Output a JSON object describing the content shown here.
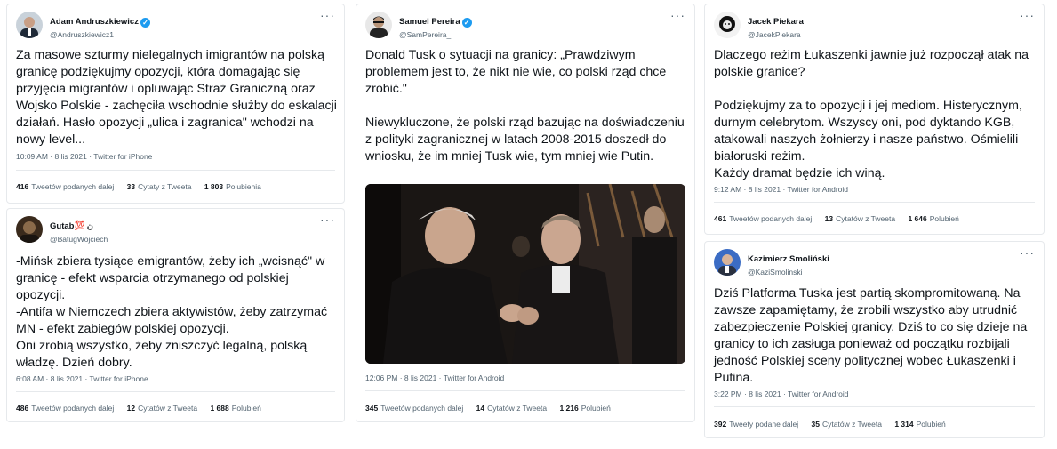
{
  "tweets": [
    {
      "author": "Adam Andruszkiewicz",
      "handle": "@Andruszkiewicz1",
      "text": "Za masowe szturmy nielegalnych imigrantów na polską granicę podziękujmy opozycji, która domagając się przyjęcia migrantów i opluwając Straż Graniczną oraz Wojsko Polskie - zachęciła wschodnie służby do eskalacji działań. Hasło opozycji „ulica i zagranica\" wchodzi na nowy level...",
      "meta": "10:09 AM · 8 lis 2021 · Twitter for iPhone",
      "retweets": "416",
      "retweets_label": "Tweetów podanych dalej",
      "quotes": "33",
      "quotes_label": "Cytaty z Tweeta",
      "likes": "1 803",
      "likes_label": "Polubienia"
    },
    {
      "author": "Gutab💯 ن",
      "handle": "@BatugWojciech",
      "text": "-Mińsk zbiera tysiące emigrantów, żeby ich „wcisnąć\" w granicę - efekt wsparcia otrzymanego od polskiej opozycji.\n-Antifa w Niemczech zbiera aktywistów, żeby zatrzymać MN - efekt zabiegów polskiej opozycji.\nOni zrobią wszystko, żeby zniszczyć legalną, polską władzę. Dzień dobry.",
      "meta": "6:08 AM · 8 lis 2021 · Twitter for iPhone",
      "retweets": "486",
      "retweets_label": "Tweetów podanych dalej",
      "quotes": "12",
      "quotes_label": "Cytatów z Tweeta",
      "likes": "1 688",
      "likes_label": "Polubień"
    },
    {
      "author": "Samuel Pereira",
      "handle": "@SamPereira_",
      "text": "Donald Tusk o sytuacji na granicy: „Prawdziwym problemem jest to, że nikt nie wie, co polski rząd chce zrobić.\"\n\nNiewykluczone, że polski rząd bazując na doświadczeniu z polityki zagranicznej w latach 2008-2015 doszedł do wniosku, że im mniej Tusk wie, tym mniej wie Putin.",
      "meta": "12:06 PM · 8 lis 2021 · Twitter for Android",
      "retweets": "345",
      "retweets_label": "Tweetów podanych dalej",
      "quotes": "14",
      "quotes_label": "Cytatów z Tweeta",
      "likes": "1 216",
      "likes_label": "Polubień"
    },
    {
      "author": "Jacek Piekara",
      "handle": "@JacekPiekara",
      "text": "Dlaczego reżim Łukaszenki jawnie już rozpoczął atak na polskie granice?\n\nPodziękujmy za to opozycji i jej mediom. Histerycznym, durnym celebrytom. Wszyscy oni, pod dyktando KGB, atakowali naszych żołnierzy i nasze państwo. Ośmielili białoruski reżim.\nKażdy dramat będzie ich winą.",
      "meta": "9:12 AM · 8 lis 2021 · Twitter for Android",
      "retweets": "461",
      "retweets_label": "Tweetów podanych dalej",
      "quotes": "13",
      "quotes_label": "Cytatów z Tweeta",
      "likes": "1 646",
      "likes_label": "Polubień"
    },
    {
      "author": "Kazimierz Smoliński",
      "handle": "@KaziSmolinski",
      "text": "Dziś Platforma Tuska jest partią skompromitowaną. Na zawsze zapamiętamy, że zrobili wszystko aby utrudnić zabezpieczenie Polskiej granicy. Dziś to co się dzieje na granicy to ich zasługa ponieważ od początku rozbijali jedność Polskiej sceny politycznej wobec Łukaszenki i Putina.",
      "meta": "3:22 PM · 8 lis 2021 · Twitter for Android",
      "retweets": "392",
      "retweets_label": "Tweety podane dalej",
      "quotes": "35",
      "quotes_label": "Cytatów z Tweeta",
      "likes": "1 314",
      "likes_label": "Polubień"
    }
  ],
  "icons": {
    "verified": "verified-badge-icon",
    "more": "more-options-icon"
  },
  "colors": {
    "verified": "#1d9bf0",
    "secondary_text": "#536471",
    "border": "#e6e9ec"
  }
}
